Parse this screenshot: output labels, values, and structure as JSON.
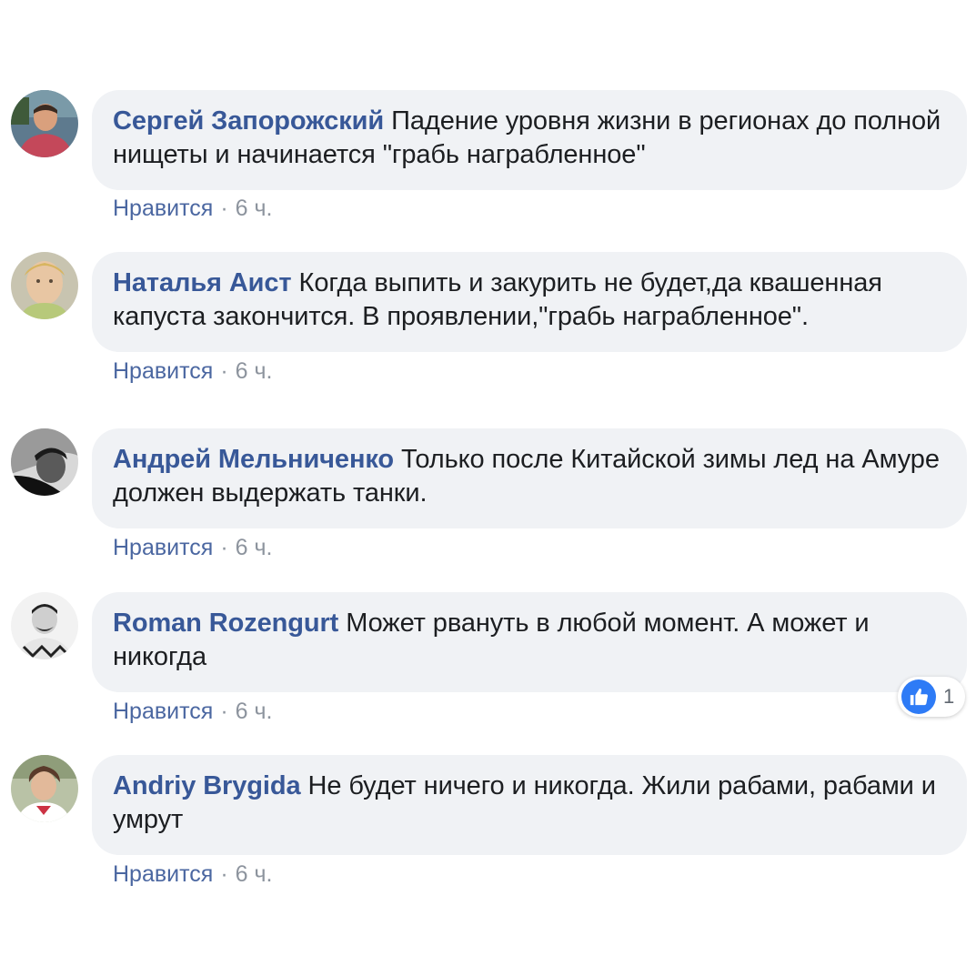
{
  "comments": [
    {
      "author": "Сергей Запорожский",
      "text": "Падение уровня жизни в регионах до полной нищеты и начинается \"грабь награбленное\"",
      "like_label": "Нравится",
      "separator": "·",
      "time": "6 ч."
    },
    {
      "author": "Наталья Аист",
      "text": "Когда выпить и закурить не будет,да квашенная капуста закончится. В проявлении,\"грабь награбленное\".",
      "like_label": "Нравится",
      "separator": "·",
      "time": "6 ч."
    },
    {
      "author": "Андрей Мельниченко",
      "text": "Только после Китайской зимы лед на Амуре должен выдержать танки.",
      "like_label": "Нравится",
      "separator": "·",
      "time": "6 ч."
    },
    {
      "author": "Roman Rozengurt",
      "text": "Может рвануть в любой момент. А может и никогда",
      "like_label": "Нравится",
      "separator": "·",
      "time": "6 ч.",
      "reaction_count": "1",
      "reaction_icon": "thumbs-up-icon"
    },
    {
      "author": "Andriy Brygida",
      "text": "Не будет ничего и никогда. Жили рабами, рабами и умрут",
      "like_label": "Нравится",
      "separator": "·",
      "time": "6 ч."
    }
  ],
  "colors": {
    "author": "#385898",
    "bubble": "#f0f2f5",
    "like_link": "#4b67a1",
    "reaction": "#2e7bf6"
  }
}
